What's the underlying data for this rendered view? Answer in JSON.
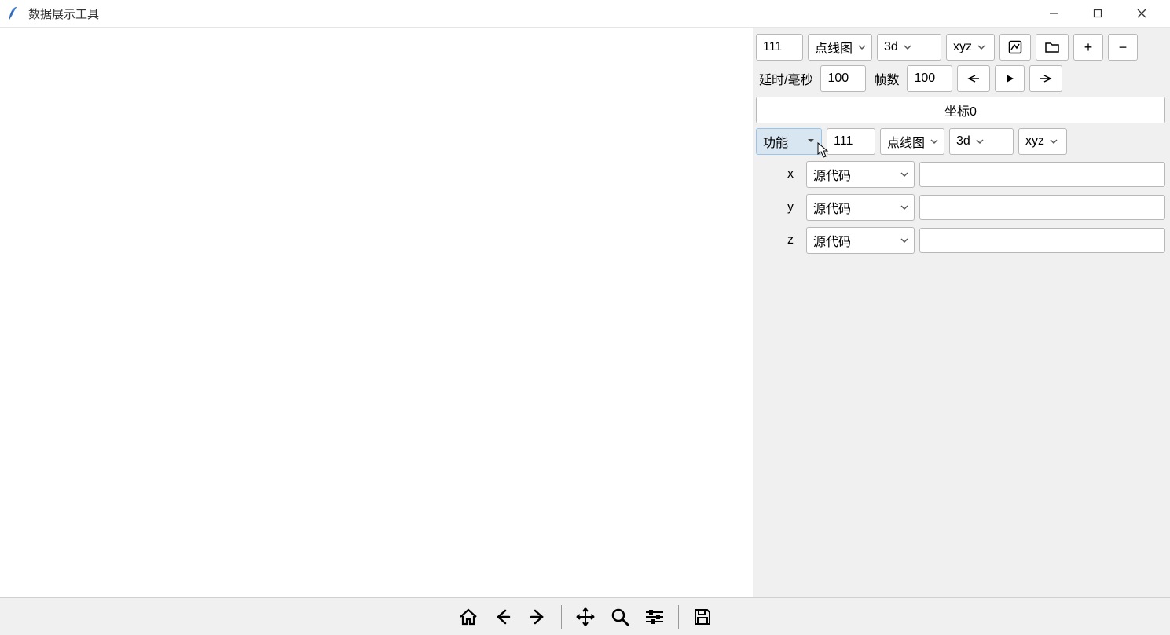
{
  "window": {
    "title": "数据展示工具"
  },
  "top_controls": {
    "series_id": "111",
    "chart_type": "点线图",
    "dimension": "3d",
    "axes_mode": "xyz",
    "plus_label": "+",
    "minus_label": "−"
  },
  "anim": {
    "delay_label": "延时/毫秒",
    "delay_value": "100",
    "frames_label": "帧数",
    "frames_value": "100"
  },
  "coord_button": "坐标0",
  "func": {
    "label": "功能",
    "series_id": "111",
    "chart_type": "点线图",
    "dimension": "3d",
    "axes_mode": "xyz"
  },
  "axes": {
    "x_label": "x",
    "x_source": "源代码",
    "x_value": "",
    "y_label": "y",
    "y_source": "源代码",
    "y_value": "",
    "z_label": "z",
    "z_source": "源代码",
    "z_value": ""
  }
}
